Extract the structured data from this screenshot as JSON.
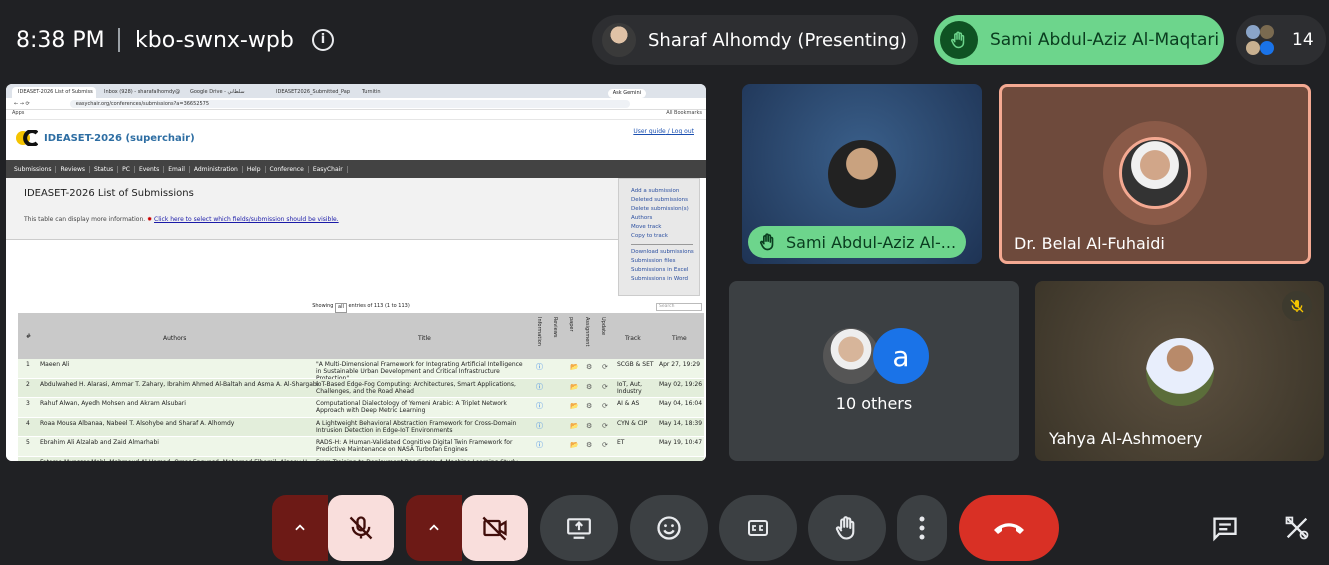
{
  "topbar": {
    "time": "8:38 PM",
    "meeting_code": "kbo-swnx-wpb",
    "presenter_chip": "Sharaf Alhomdy (Presenting)",
    "raised_hand_chip": "Sami Abdul-Aziz Al-Maqtari",
    "participant_count": "14"
  },
  "browser": {
    "tabs": [
      "IDEASET-2026 List of Submiss",
      "Inbox (928) - sharafalhomdy@",
      "Google Drive - سلطاني",
      "IDEASET2026_Submitted_Pap",
      "Turnitin"
    ],
    "ask_gemini": "Ask Gemini",
    "url": "easychair.org/conferences/submissions?a=36652575",
    "apps": "Apps",
    "all_bookmarks": "All Bookmarks"
  },
  "easychair": {
    "title": "IDEASET-2026 (superchair)",
    "links": {
      "guide": "User guide",
      "logout": "Log out"
    },
    "menu": [
      "Submissions",
      "Reviews",
      "Status",
      "PC",
      "Events",
      "Email",
      "Administration",
      "Help",
      "Conference",
      "EasyChair"
    ],
    "heading": "IDEASET-2026 List of Submissions",
    "note": "This table can display more information.",
    "note_link": "Click here to select which fields/submission should be visible.",
    "side": [
      "Add a submission",
      "Deleted submissions",
      "Delete submission(s)",
      "Authors",
      "Move track",
      "Copy to track"
    ],
    "side2": [
      "Download submissions",
      "Submission files",
      "Submissions in Excel",
      "Submissions in Word"
    ],
    "showing": "Showing",
    "showing_sel": "all",
    "showing_rest": "entries of 113 (1 to 113)",
    "search_placeholder": "Search",
    "headers": {
      "num": "#",
      "authors": "Authors",
      "title": "Title",
      "information": "Information",
      "reviews": "Reviews",
      "paper": "paper",
      "assignment": "Assignment",
      "update": "Update",
      "track": "Track",
      "time": "Time"
    },
    "rows": [
      {
        "num": "1",
        "authors": "Maeen Ali",
        "title": "\"A Multi-Dimensional Framework for Integrating Artificial Intelligence in Sustainable Urban Development and Critical Infrastructure Protection\"",
        "track": "SCGB & SET",
        "time": "Apr 27, 19:29"
      },
      {
        "num": "2",
        "authors": "Abdulwahed H. Alarasi, Ammar T. Zahary, Ibrahim Ahmed Al-Baltah and Asma A. Al-Shargabi",
        "title": "IoT-Based Edge-Fog Computing: Architectures, Smart Applications, Challenges, and the Road Ahead",
        "track": "IoT, Aut, Industry",
        "time": "May 02, 19:26"
      },
      {
        "num": "3",
        "authors": "Rahuf Alwan, Ayedh Mohsen and Akram Alsubari",
        "title": "Computational Dialectology of Yemeni Arabic: A Triplet Network Approach with Deep Metric Learning",
        "track": "AI & AS",
        "time": "May 04, 16:04"
      },
      {
        "num": "4",
        "authors": "Roaa Mousa Albanaa, Nabeel T. Alsohybe and Sharaf A. Alhomdy",
        "title": "A Lightweight Behavioral Abstraction Framework for Cross-Domain Intrusion Detection in Edge-IoT Environments",
        "track": "CYN & CIP",
        "time": "May 14, 18:39"
      },
      {
        "num": "5",
        "authors": "Ebrahim Ali Alzalab and Zaid Almarhabi",
        "title": "RADS-H: A Human-Validated Cognitive Digital Twin Framework for Predictive Maintenance on NASA Turbofan Engines",
        "track": "ET",
        "time": "May 19, 10:47"
      },
      {
        "num": "",
        "authors": "Fatema Munssar Mahl, Mahmoud Al-Hamad, Omar Enqunsd, Mohamed Elhamil, Algeey H.",
        "title": "From Training to Deployment Readiness: A Machine Learning Study",
        "track": "",
        "time": ""
      }
    ]
  },
  "tiles": {
    "sami": "Sami Abdul-Aziz Al-...",
    "belal": "Dr. Belal Al-Fuhaidi",
    "others": "10 others",
    "others_initial": "a",
    "yahya": "Yahya Al-Ashmoery"
  },
  "icons": [
    "info-icon",
    "hand-icon",
    "mic-off-icon",
    "video-off-icon",
    "present-icon",
    "emoji-icon",
    "captions-icon",
    "raise-hand-icon",
    "more-icon",
    "end-call-icon",
    "chat-icon",
    "activities-icon"
  ],
  "colors": {
    "raise_green": "#6dd58c",
    "end_red": "#d93025",
    "mute_bg": "#f9dedc"
  }
}
